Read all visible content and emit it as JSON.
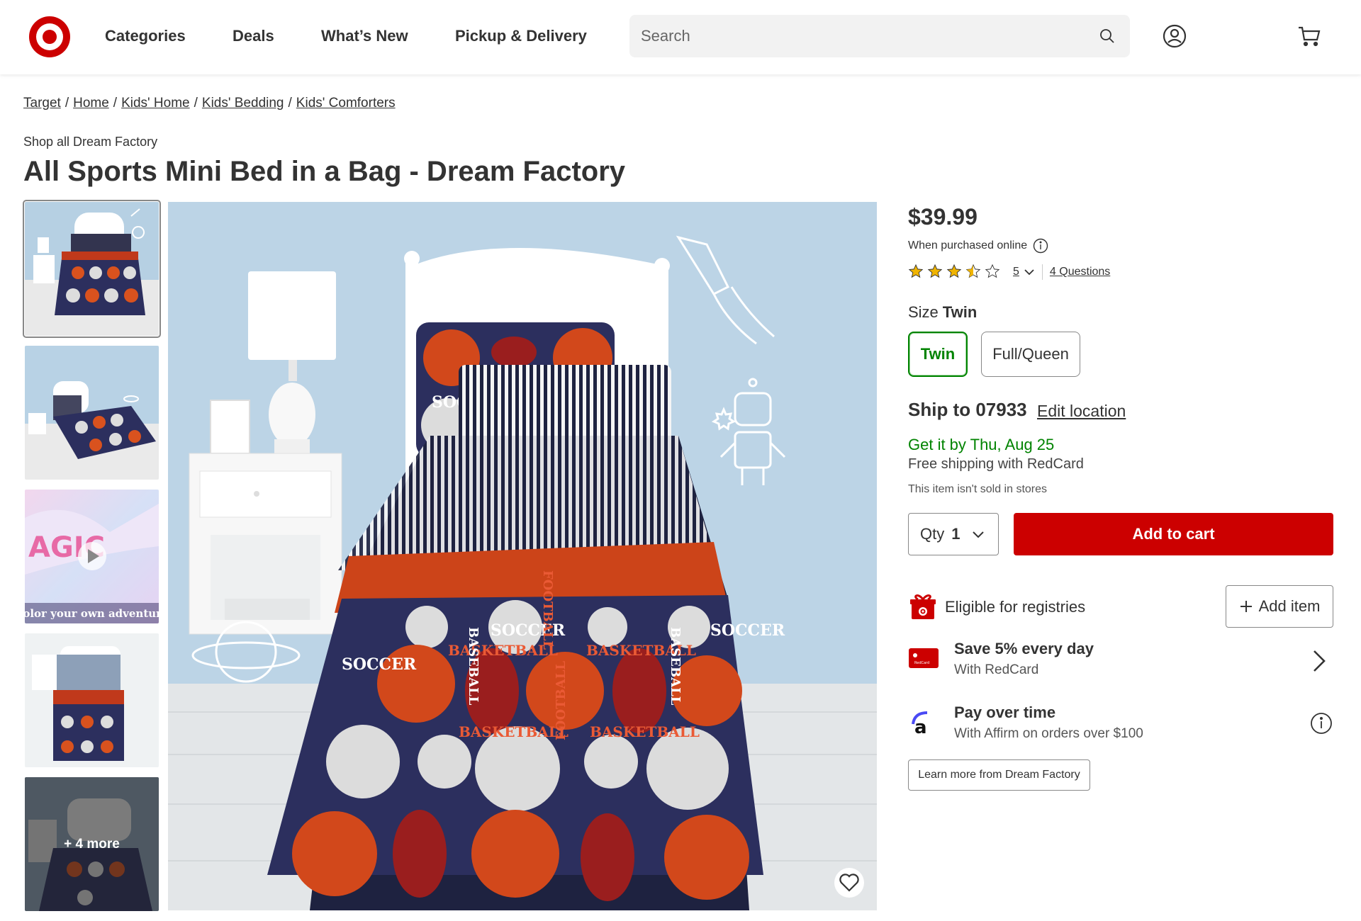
{
  "header": {
    "nav": [
      "Categories",
      "Deals",
      "What’s New",
      "Pickup & Delivery"
    ],
    "search_placeholder": "Search"
  },
  "breadcrumb": [
    "Target",
    "Home",
    "Kids' Home",
    "Kids' Bedding",
    "Kids' Comforters"
  ],
  "product": {
    "shop_all": "Shop all Dream Factory",
    "title": "All Sports Mini Bed in a Bag - Dream Factory",
    "price": "$39.99",
    "price_note": "When purchased online",
    "rating": {
      "stars": 3.5,
      "count": "5",
      "questions": "4 Questions"
    },
    "size_label": "Size",
    "size_selected": "Twin",
    "sizes": [
      "Twin",
      "Full/Queen"
    ]
  },
  "thumbnails": {
    "video_caption_word": "AGIC",
    "video_caption": "Color your own adventure",
    "more_label": "+ 4 more"
  },
  "image_text": {
    "soccer": "SOCCER",
    "basketball": "BASKETBALL",
    "baseball": "BASEBALL",
    "football": "FOOTBALL"
  },
  "fulfillment": {
    "ship_to": "Ship to 07933",
    "edit_location": "Edit location",
    "get_it": "Get it by Thu, Aug 25",
    "free_shipping": "Free shipping with RedCard",
    "not_sold": "This item isn't sold in stores"
  },
  "purchase": {
    "qty_label": "Qty",
    "qty_value": "1",
    "add_to_cart": "Add to cart"
  },
  "registry": {
    "text": "Eligible for registries",
    "add_item": "Add item"
  },
  "redcard": {
    "title": "Save 5% every day",
    "subtitle": "With RedCard",
    "card_text": "RedCard"
  },
  "affirm": {
    "title": "Pay over time",
    "subtitle": "With Affirm on orders over $100"
  },
  "learn_more": "Learn more from Dream Factory",
  "colors": {
    "target_red": "#cc0000",
    "success_green": "#008300"
  }
}
